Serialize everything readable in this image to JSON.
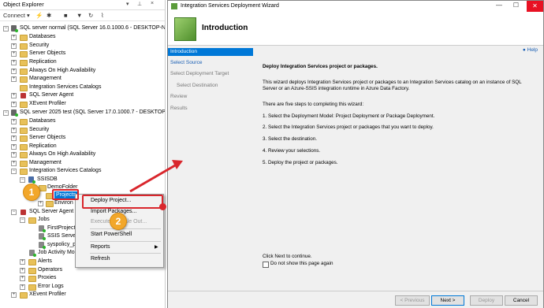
{
  "object_explorer": {
    "title": "Object Explorer",
    "pin_icon": "pin-icon",
    "close_icon": "close-icon",
    "toolbar": {
      "connect_label": "Connect ▾"
    },
    "servers": [
      {
        "label": "SQL server normal (SQL Server 16.0.1000.6 - DESKTOP-NE"
      },
      {
        "label": "SQL server 2025 test (SQL Server 17.0.1000.7 - DESKTOP-N"
      }
    ],
    "server1_children": [
      "Databases",
      "Security",
      "Server Objects",
      "Replication",
      "Always On High Availability",
      "Management",
      "Integration Services Catalogs",
      "SQL Server Agent",
      "XEvent Profiler"
    ],
    "server2_children": [
      "Databases",
      "Security",
      "Server Objects",
      "Replication",
      "Always On High Availability",
      "Management",
      "Integration Services Catalogs"
    ],
    "ssisdb": "SSISDB",
    "demo_folder": "DemoFolder",
    "projects": "Projects",
    "environments": "Environ",
    "agent": "SQL Server Agent",
    "jobs": "Jobs",
    "job_items": [
      "FirstProject",
      "SSIS Server",
      "syspolicy_p"
    ],
    "job_activity": "Job Activity Mo",
    "agent_rest": [
      "Alerts",
      "Operators",
      "Proxies",
      "Error Logs"
    ],
    "xevent": "XEvent Profiler"
  },
  "context_menu": {
    "items": [
      "Deploy Project...",
      "Import Packages...",
      "Execute in Scale Out...",
      "Start PowerShell",
      "Reports",
      "Refresh"
    ]
  },
  "callouts": {
    "one": "1",
    "two": "2"
  },
  "wizard": {
    "window_title": "Integration Services Deployment Wizard",
    "header": "Introduction",
    "nav": [
      "Introduction",
      "Select Source",
      "Select Deployment Target",
      "Select Destination",
      "Review",
      "Results"
    ],
    "help": "Help",
    "heading": "Deploy Integration Services project or packages.",
    "para1": "This wizard deploys Integration Services project or packages to an Integration Services catalog on an instance of SQL Server or an Azure-SSIS integration runtime in Azure Data Factory.",
    "steps_intro": "There are five steps to completing this wizard:",
    "steps": [
      "1. Select the Deployment Model: Project Deployment or Package Deployment.",
      "2. Select the Integration Services project or packages that you want to deploy.",
      "3. Select the destination.",
      "4. Review your selections.",
      "5. Deploy the project or packages."
    ],
    "click_next": "Click Next to continue.",
    "dont_show": "Do not show this page again",
    "buttons": {
      "previous": "< Previous",
      "next": "Next >",
      "deploy": "Deploy",
      "cancel": "Cancel"
    }
  },
  "colors": {
    "accent": "#0078d7",
    "callout": "#f2a72b",
    "highlight": "#d9262c"
  }
}
